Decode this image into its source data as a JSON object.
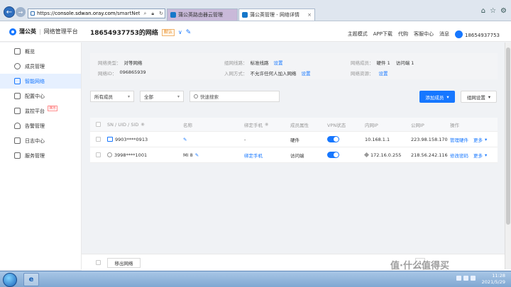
{
  "browser": {
    "url_prefix": "https://",
    "url_host": "console.sdwan.oray.com",
    "url_path": "/smartNetwork",
    "tabs": [
      {
        "title": "蒲公英路由器云管理"
      },
      {
        "title": "蒲公英管理 - 网络详情"
      }
    ]
  },
  "header": {
    "brand": "蒲公英",
    "product": "网络管理平台",
    "title": "18654937753的网络",
    "default_badge": "默认",
    "menu": [
      "主题模式",
      "APP下载",
      "代购",
      "客服中心",
      "消息"
    ],
    "user": "18654937753"
  },
  "sidebar": {
    "items": [
      {
        "label": "概览"
      },
      {
        "label": "成员管理"
      },
      {
        "label": "智能网络"
      },
      {
        "label": "配置中心"
      },
      {
        "label": "监控平台",
        "tag": "演示"
      },
      {
        "label": "告警管理"
      },
      {
        "label": "日志中心"
      },
      {
        "label": "服务管理"
      }
    ]
  },
  "info": {
    "network_type_k": "网络类型：",
    "network_type_v": "对等网络",
    "network_id_k": "网络ID：",
    "network_id_v": "096865939",
    "route_k": "组网线路：",
    "route_v": "标准线路",
    "route_link": "设置",
    "join_k": "入网方式：",
    "join_v": "不允许任何人加入网络",
    "join_link": "设置",
    "members_k": "网络成员：",
    "members_v1": "硬件 1",
    "members_v2": "访问端 1",
    "resource_k": "网络资源：",
    "resource_link": "设置"
  },
  "toolbar": {
    "filter1": "所有成员",
    "filter2": "全部",
    "search_placeholder": "快速搜索",
    "add_member": "添加成员",
    "group_settings": "组网设置"
  },
  "table": {
    "headers": [
      "SN / UID / SID",
      "名称",
      "绑定手机",
      "成员属性",
      "VPN状态",
      "内网IP",
      "公网IP",
      "操作"
    ],
    "rows": [
      {
        "id": "9903****0913",
        "name": "",
        "phone": "-",
        "type": "硬件",
        "lan_ip": "10.168.1.1",
        "wan_ip": "223.98.158.170",
        "action": "管理硬件",
        "more": "更多"
      },
      {
        "id": "3998****1001",
        "name": "MI 8",
        "phone": "绑定手机",
        "type": "访问端",
        "lan_ip": "172.16.0.255",
        "wan_ip": "218.56.242.116",
        "action": "修改密码",
        "more": "更多"
      }
    ]
  },
  "footer": {
    "remove_button": "移出网络",
    "page": "1"
  },
  "taskbar": {
    "time": "11:28",
    "date": "2021/5/29"
  },
  "watermark": "值·什么值得买"
}
